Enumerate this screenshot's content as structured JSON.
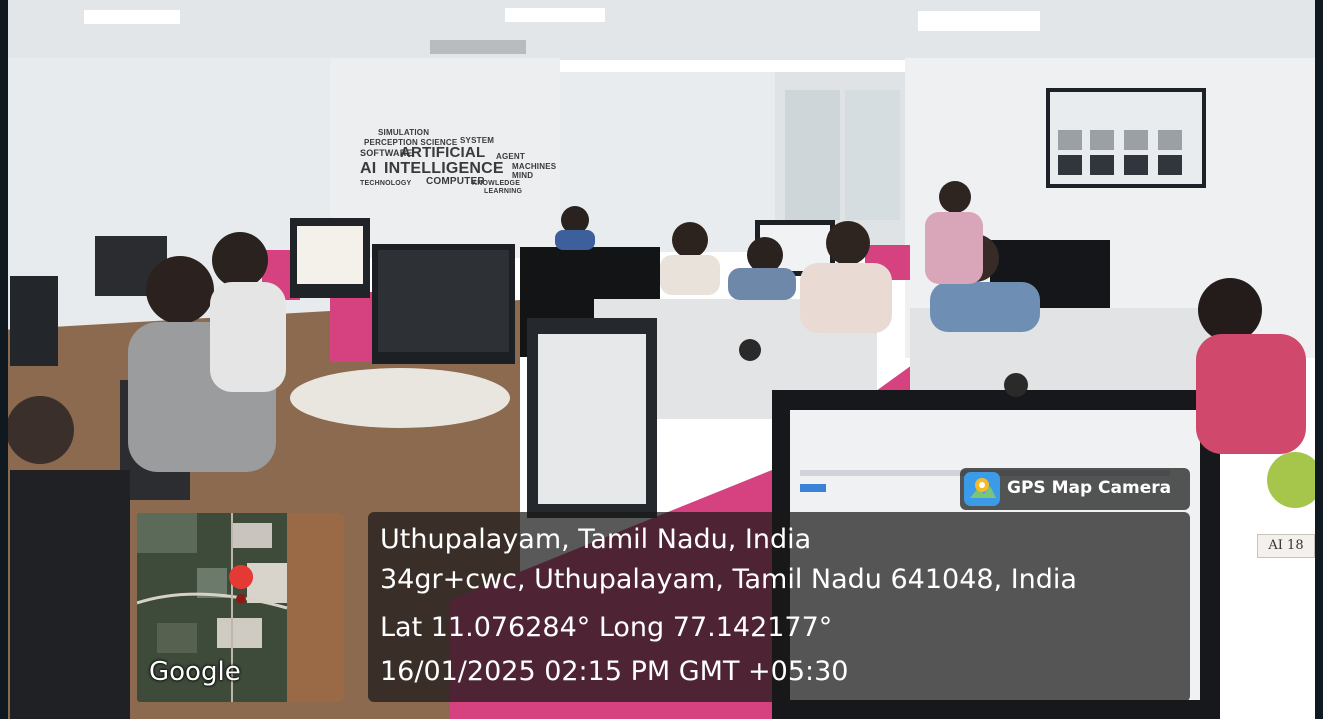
{
  "wall_text": {
    "line1": "SIMULATION",
    "line2": "PERCEPTION SCIENCE",
    "line3": "SYSTEM",
    "line4": "SOFTWARE",
    "line5": "ARTIFICIAL",
    "line6": "AGENT",
    "line7": "AI",
    "line8": "INTELLIGENCE",
    "line9": "MACHINES",
    "line10": "MIND",
    "line11": "COMPUTER",
    "line12": "TECHNOLOGY",
    "line13": "KNOWLEDGE",
    "line14": "LEARNING"
  },
  "desk_label": "AI 18",
  "gps_badge": {
    "label": "GPS Map Camera"
  },
  "map_thumbnail": {
    "logo_text": "Google"
  },
  "location": {
    "place": "Uthupalayam, Tamil Nadu, India",
    "address": "34gr+cwc, Uthupalayam, Tamil Nadu 641048, India",
    "coordinates": "Lat 11.076284° Long 77.142177°",
    "timestamp": "16/01/2025 02:15 PM GMT +05:30"
  },
  "colors": {
    "partition_pink": "#d6417f",
    "wall": "#e9ecee",
    "floor": "#8c6a4f",
    "overlay": "#191919",
    "map_pin": "#e53935"
  }
}
